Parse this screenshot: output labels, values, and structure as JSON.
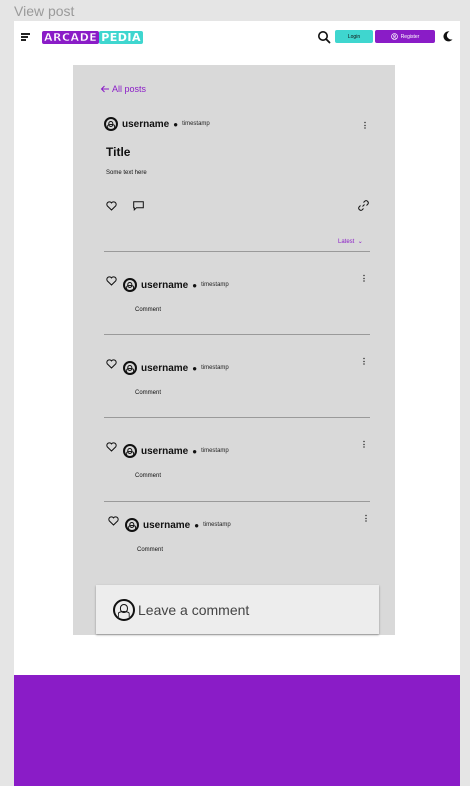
{
  "frame": {
    "label": "View post"
  },
  "nav": {
    "logo_part1": "ARCADE",
    "logo_part2": "PEDIA",
    "login_label": "Login",
    "register_label": "Register"
  },
  "post": {
    "back_label": "All posts",
    "username": "username",
    "timestamp": "timestamp",
    "title": "Title",
    "text": "Some text here"
  },
  "comments": {
    "sort_label": "Latest",
    "items": [
      {
        "username": "username",
        "timestamp": "timestamp",
        "text": "Comment"
      },
      {
        "username": "username",
        "timestamp": "timestamp",
        "text": "Comment"
      },
      {
        "username": "username",
        "timestamp": "timestamp",
        "text": "Comment"
      },
      {
        "username": "username",
        "timestamp": "timestamp",
        "text": "Comment"
      }
    ]
  },
  "leave_comment": {
    "placeholder": "Leave a comment"
  },
  "colors": {
    "brand_purple": "#8a1cc7",
    "accent_teal": "#3fd6cf"
  },
  "icons": [
    "menu-icon",
    "search-icon",
    "user-icon",
    "moon-icon",
    "arrow-left-icon",
    "more-vertical-icon",
    "heart-icon",
    "comment-icon",
    "link-icon",
    "chevron-down-icon"
  ]
}
